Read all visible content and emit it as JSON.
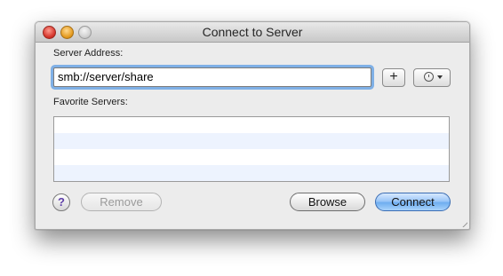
{
  "window": {
    "title": "Connect to Server"
  },
  "server_address": {
    "label": "Server Address:",
    "value": "smb://server/share"
  },
  "favorites": {
    "label": "Favorite Servers:",
    "items": []
  },
  "buttons": {
    "add": "+",
    "help": "?",
    "remove": "Remove",
    "browse": "Browse",
    "connect": "Connect"
  },
  "icons": {
    "recent_servers": "clock-icon",
    "menu_arrow": "chevron-down-icon"
  }
}
